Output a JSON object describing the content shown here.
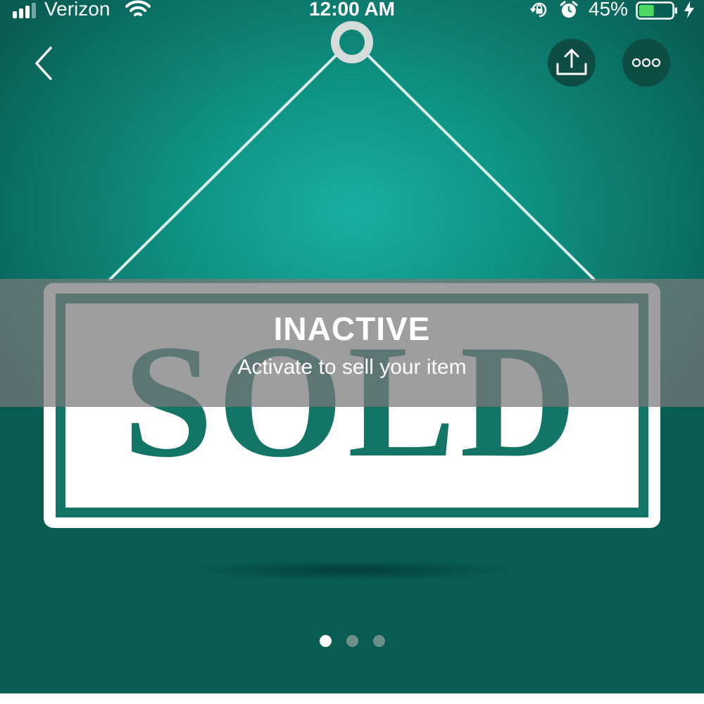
{
  "status_bar": {
    "carrier": "Verizon",
    "time": "12:00 AM",
    "battery_percent": "45%",
    "battery_level": 0.45,
    "icons": [
      "signal-icon",
      "wifi-icon",
      "rotation-lock-icon",
      "alarm-icon",
      "battery-icon",
      "charging-icon"
    ]
  },
  "nav": {
    "back_icon": "chevron-left-icon",
    "share_icon": "share-icon",
    "more_icon": "more-horizontal-icon"
  },
  "listing_image": {
    "sign_text": "SOLD"
  },
  "overlay": {
    "title": "INACTIVE",
    "subtitle": "Activate to sell your item"
  },
  "carousel": {
    "page_count": 3,
    "active_index": 0
  },
  "colors": {
    "teal_background": "#0f9283",
    "sign_text": "#137565",
    "overlay": "#787878",
    "button_background": "#0e4d44",
    "dot_active": "#ffffff",
    "dot_inactive": "#6c8f8a"
  }
}
